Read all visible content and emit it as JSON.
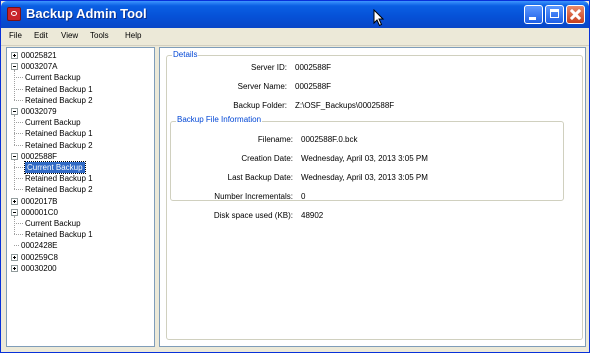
{
  "window": {
    "title": "Backup Admin Tool"
  },
  "menu": [
    "File",
    "Edit",
    "View",
    "Tools",
    "Help"
  ],
  "tree": [
    {
      "label": "00025821",
      "level": 0,
      "expander": "collapsed"
    },
    {
      "label": "0003207A",
      "level": 0,
      "expander": "expanded"
    },
    {
      "label": "Current Backup",
      "level": 1
    },
    {
      "label": "Retained Backup 1",
      "level": 1
    },
    {
      "label": "Retained Backup 2",
      "level": 1
    },
    {
      "label": "00032079",
      "level": 0,
      "expander": "expanded"
    },
    {
      "label": "Current Backup",
      "level": 1
    },
    {
      "label": "Retained Backup 1",
      "level": 1
    },
    {
      "label": "Retained Backup 2",
      "level": 1
    },
    {
      "label": "0002588F",
      "level": 0,
      "expander": "expanded"
    },
    {
      "label": "Current Backup",
      "level": 1,
      "selected": true
    },
    {
      "label": "Retained Backup 1",
      "level": 1
    },
    {
      "label": "Retained Backup 2",
      "level": 1
    },
    {
      "label": "0002017B",
      "level": 0,
      "expander": "collapsed"
    },
    {
      "label": "000001C0",
      "level": 0,
      "expander": "expanded"
    },
    {
      "label": "Current Backup",
      "level": 1
    },
    {
      "label": "Retained Backup 1",
      "level": 1
    },
    {
      "label": "0002428E",
      "level": 0,
      "expander": "none"
    },
    {
      "label": "000259C8",
      "level": 0,
      "expander": "collapsed"
    },
    {
      "label": "00030200",
      "level": 0,
      "expander": "collapsed"
    }
  ],
  "details": {
    "title": "Details",
    "server_id_label": "Server ID:",
    "server_id": "0002588F",
    "server_name_label": "Server Name:",
    "server_name": "0002588F",
    "backup_folder_label": "Backup Folder:",
    "backup_folder": "Z:\\OSF_Backups\\0002588F",
    "file_info": {
      "title": "Backup File Information",
      "filename_label": "Filename:",
      "filename": "0002588F.0.bck",
      "creation_label": "Creation Date:",
      "creation": "Wednesday, April 03, 2013 3:05 PM",
      "last_label": "Last Backup Date:",
      "last": "Wednesday, April 03, 2013 3:05 PM",
      "incrementals_label": "Number Incrementals:",
      "incrementals": "0",
      "disk_label": "Disk space used (KB):",
      "disk": "48902"
    }
  },
  "colors": {
    "titlebar": "#0A5FE3",
    "selection": "#316AC5",
    "group_title": "#0046D5",
    "chrome": "#ECE9D8"
  }
}
